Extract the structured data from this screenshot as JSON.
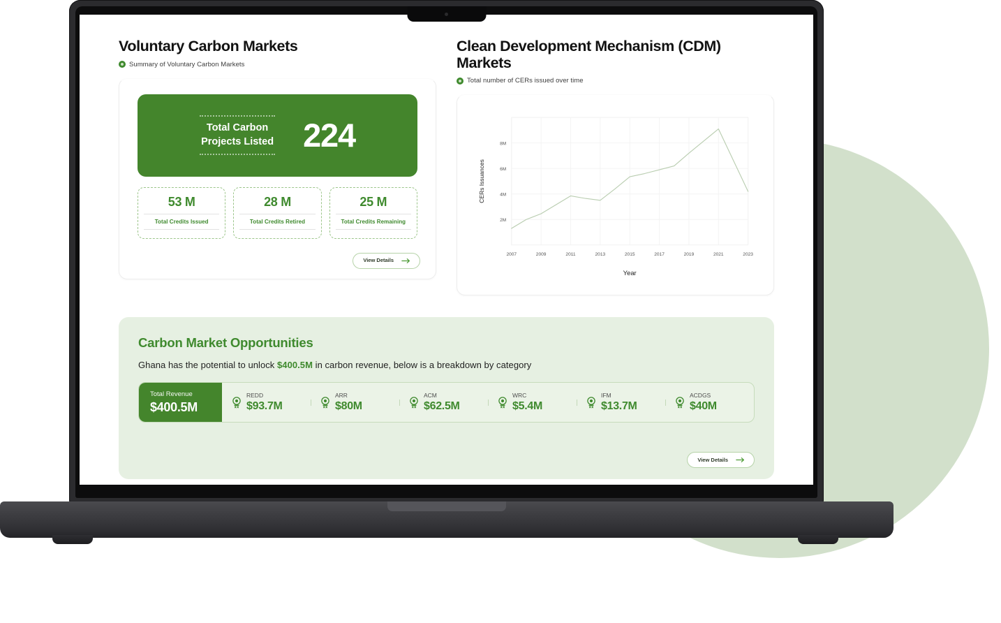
{
  "device": {
    "type": "laptop",
    "camera": "camera-dot"
  },
  "decor": {
    "circle_color": "#d2e0cb"
  },
  "theme": {
    "brand_green": "#3f8a2e",
    "hero_green": "#44852c",
    "pale_green_bg": "#e6f0e2",
    "dashed_border": "#9cc58a"
  },
  "left_panel": {
    "title": "Voluntary Carbon Markets",
    "subtitle": "Summary of Voluntary Carbon Markets",
    "subtitle_icon": "info-circle-icon",
    "hero": {
      "label": "Total Carbon\nProjects Listed",
      "label_line1": "Total Carbon",
      "label_line2": "Projects Listed",
      "value": "224"
    },
    "stats": [
      {
        "value": "53 M",
        "label": "Total Credits Issued"
      },
      {
        "value": "28 M",
        "label": "Total Credits Retired"
      },
      {
        "value": "25 M",
        "label": "Total Credits Remaining"
      }
    ],
    "view_details_label": "View Details"
  },
  "right_panel": {
    "title": "Clean Development Mechanism (CDM) Markets",
    "subtitle": "Total number of CERs issued over time",
    "subtitle_icon": "info-circle-icon"
  },
  "chart_data": {
    "type": "line",
    "title": "",
    "xlabel": "Year",
    "ylabel": "CERs Issuances",
    "x": [
      2007,
      2008,
      2009,
      2010,
      2011,
      2012,
      2013,
      2014,
      2015,
      2016,
      2017,
      2018,
      2019,
      2020,
      2021,
      2022,
      2023
    ],
    "values": [
      1.3,
      2.0,
      2.45,
      3.15,
      3.85,
      3.65,
      3.5,
      4.4,
      5.35,
      5.6,
      5.9,
      6.2,
      7.2,
      8.15,
      9.1,
      6.65,
      4.2
    ],
    "xticks": [
      "2007",
      "2009",
      "2011",
      "2013",
      "2015",
      "2017",
      "2019",
      "2021",
      "2023"
    ],
    "yticks": [
      "2M",
      "4M",
      "6M",
      "8M"
    ],
    "ytick_values": [
      2,
      4,
      6,
      8
    ],
    "ylim": [
      0,
      10
    ],
    "xlim": [
      2007,
      2023
    ],
    "grid": true,
    "legend": "none",
    "line_color": "#b9cdb0",
    "units": "millions of CERs"
  },
  "opportunities": {
    "title": "Carbon Market Opportunities",
    "description_prefix": "Ghana has the potential to unlock ",
    "description_highlight": "$400.5M",
    "description_suffix": " in carbon revenue, below is a breakdown by category",
    "total": {
      "label": "Total Revenue",
      "value": "$400.5M"
    },
    "items": [
      {
        "name": "REDD",
        "value": "$93.7M",
        "icon": "medal-icon"
      },
      {
        "name": "ARR",
        "value": "$80M",
        "icon": "medal-icon"
      },
      {
        "name": "ACM",
        "value": "$62.5M",
        "icon": "medal-icon"
      },
      {
        "name": "WRC",
        "value": "$5.4M",
        "icon": "medal-icon"
      },
      {
        "name": "IFM",
        "value": "$13.7M",
        "icon": "medal-icon"
      },
      {
        "name": "ACDGS",
        "value": "$40M",
        "icon": "medal-icon"
      }
    ],
    "view_details_label": "View Details"
  }
}
